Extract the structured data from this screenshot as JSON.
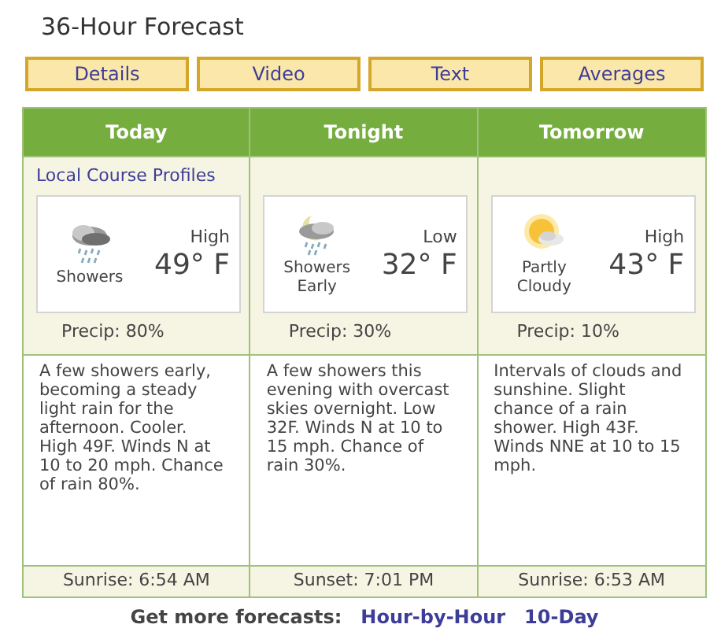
{
  "title": "36-Hour Forecast",
  "buttons": [
    "Details",
    "Video",
    "Text",
    "Averages"
  ],
  "periods": [
    {
      "name": "Today",
      "link": "Local Course Profiles",
      "kind": "showers",
      "condition": "Showers",
      "temp_label": "High",
      "temp": "49° F",
      "precip": "Precip: 80%",
      "description": "A few showers early, becoming a steady light rain for the afternoon. Cooler. High 49F. Winds N at 10 to 20 mph. Chance of rain 80%.",
      "sun": "Sunrise: 6:54 AM"
    },
    {
      "name": "Tonight",
      "kind": "showers-night",
      "condition": "Showers Early",
      "temp_label": "Low",
      "temp": "32° F",
      "precip": "Precip: 30%",
      "description": "A few showers this evening with overcast skies overnight. Low 32F. Winds N at 10 to 15 mph. Chance of rain 30%.",
      "sun": "Sunset: 7:01 PM"
    },
    {
      "name": "Tomorrow",
      "kind": "partly-cloudy",
      "condition": "Partly Cloudy",
      "temp_label": "High",
      "temp": "43° F",
      "precip": "Precip: 10%",
      "description": "Intervals of clouds and sunshine. Slight chance of a rain shower. High 43F. Winds NNE at 10 to 15 mph.",
      "sun": "Sunrise: 6:53 AM"
    }
  ],
  "footer": {
    "label": "Get more forecasts:",
    "links": [
      "Hour-by-Hour",
      "10-Day"
    ]
  }
}
